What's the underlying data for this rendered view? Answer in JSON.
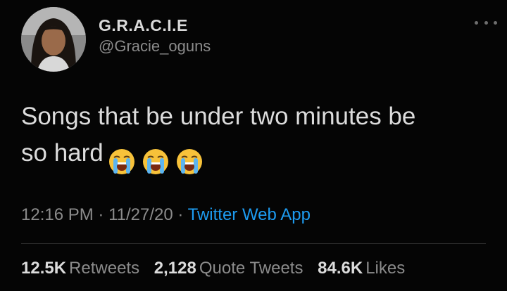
{
  "header": {
    "display_name": "G.R.A.C.I.E",
    "handle": "@Gracie_oguns",
    "more_icon": "ellipsis-icon"
  },
  "tweet": {
    "text_line1": "Songs that be under two minutes be",
    "text_line2": "so hard",
    "emojis": [
      "loudly-crying-face-icon",
      "loudly-crying-face-icon",
      "loudly-crying-face-icon"
    ]
  },
  "meta": {
    "time": "12:16 PM",
    "separator1": " · ",
    "date": "11/27/20",
    "separator2": " · ",
    "source": "Twitter Web App"
  },
  "stats": {
    "retweets_count": "12.5K",
    "retweets_label": "Retweets",
    "quotes_count": "2,128",
    "quotes_label": "Quote Tweets",
    "likes_count": "84.6K",
    "likes_label": "Likes"
  },
  "colors": {
    "background": "#050505",
    "text": "#dcdcdc",
    "secondary": "#8b8b8b",
    "link": "#1d9bf0"
  }
}
